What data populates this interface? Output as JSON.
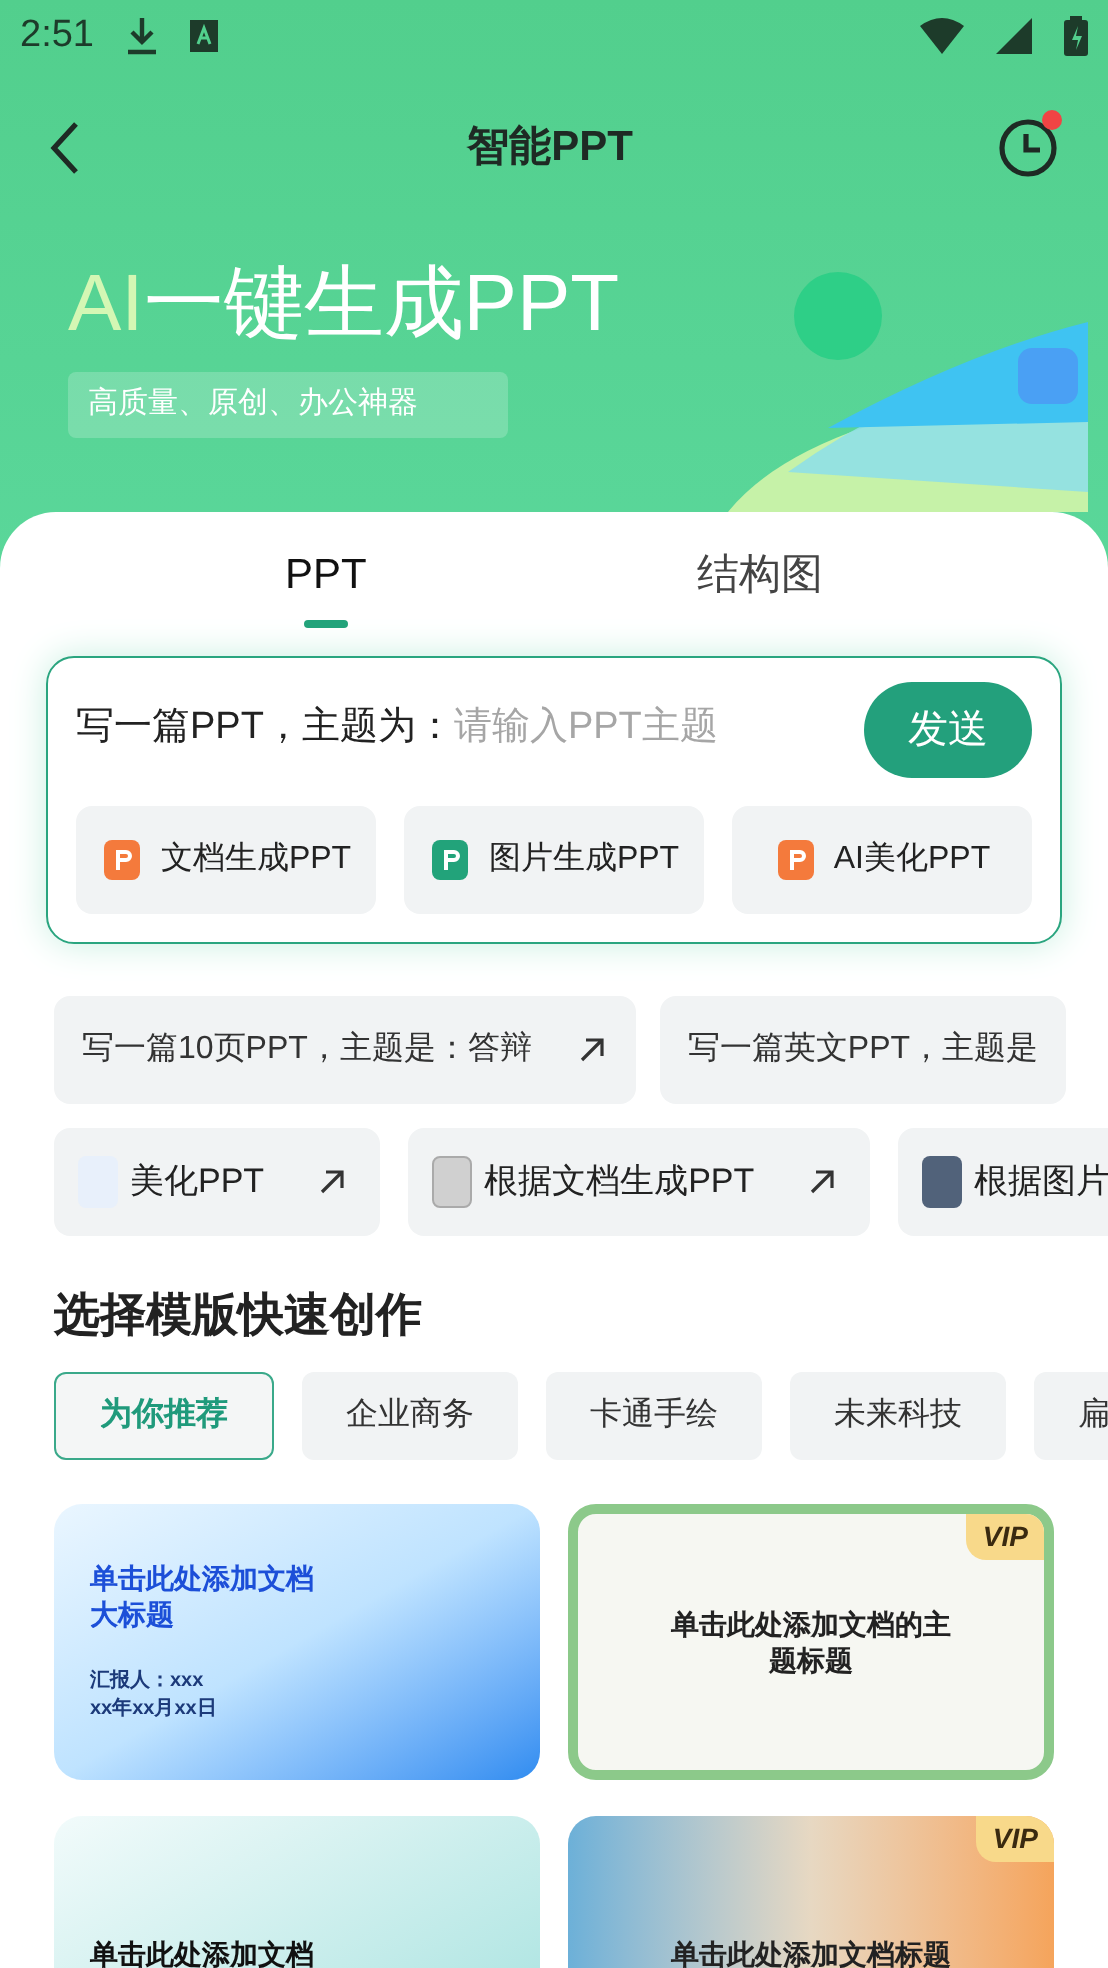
{
  "status_bar": {
    "time": "2:51"
  },
  "header": {
    "title": "智能PPT",
    "has_notification": true
  },
  "banner": {
    "title_highlight": "AI",
    "title_rest": "一键生成PPT",
    "subtitle": "高质量、原创、办公神器"
  },
  "tabs": [
    {
      "label": "PPT",
      "selected": true
    },
    {
      "label": "结构图",
      "selected": false
    }
  ],
  "prompt": {
    "prefix": "写一篇PPT，主题为：",
    "placeholder": "请输入PPT主题",
    "send": "发送"
  },
  "tools": [
    {
      "label": "文档生成PPT",
      "color": "#f47a3c"
    },
    {
      "label": "图片生成PPT",
      "color": "#22a37a"
    },
    {
      "label": "AI美化PPT",
      "color": "#f47a3c"
    }
  ],
  "suggestions": [
    {
      "label": "写一篇10页PPT，主题是：答辩",
      "kind": "arrow"
    },
    {
      "label": "写一篇英文PPT，主题是",
      "kind": "plain"
    }
  ],
  "examples": [
    {
      "label": "美化PPT",
      "kind": "slide"
    },
    {
      "label": "根据文档生成PPT",
      "kind": "document"
    },
    {
      "label": "根据图片",
      "kind": "photo"
    }
  ],
  "templates_section": {
    "title": "选择模版快速创作"
  },
  "categories": [
    {
      "label": "为你推荐",
      "selected": true
    },
    {
      "label": "企业商务",
      "selected": false
    },
    {
      "label": "卡通手绘",
      "selected": false
    },
    {
      "label": "未来科技",
      "selected": false
    },
    {
      "label": "扁",
      "selected": false
    }
  ],
  "templates": [
    {
      "title": "单击此处添加文档大标题",
      "lines": [
        "汇报人：xxx",
        "xx年xx月xx日"
      ],
      "kind": "blue"
    },
    {
      "title": "单击此处添加文档的主题标题",
      "badge": "VIP",
      "kind": "nature"
    },
    {
      "title": "单击此处添加文档",
      "kind": "teal"
    },
    {
      "title": "单击此处添加文档标题",
      "badge": "VIP",
      "kind": "sunset"
    }
  ]
}
